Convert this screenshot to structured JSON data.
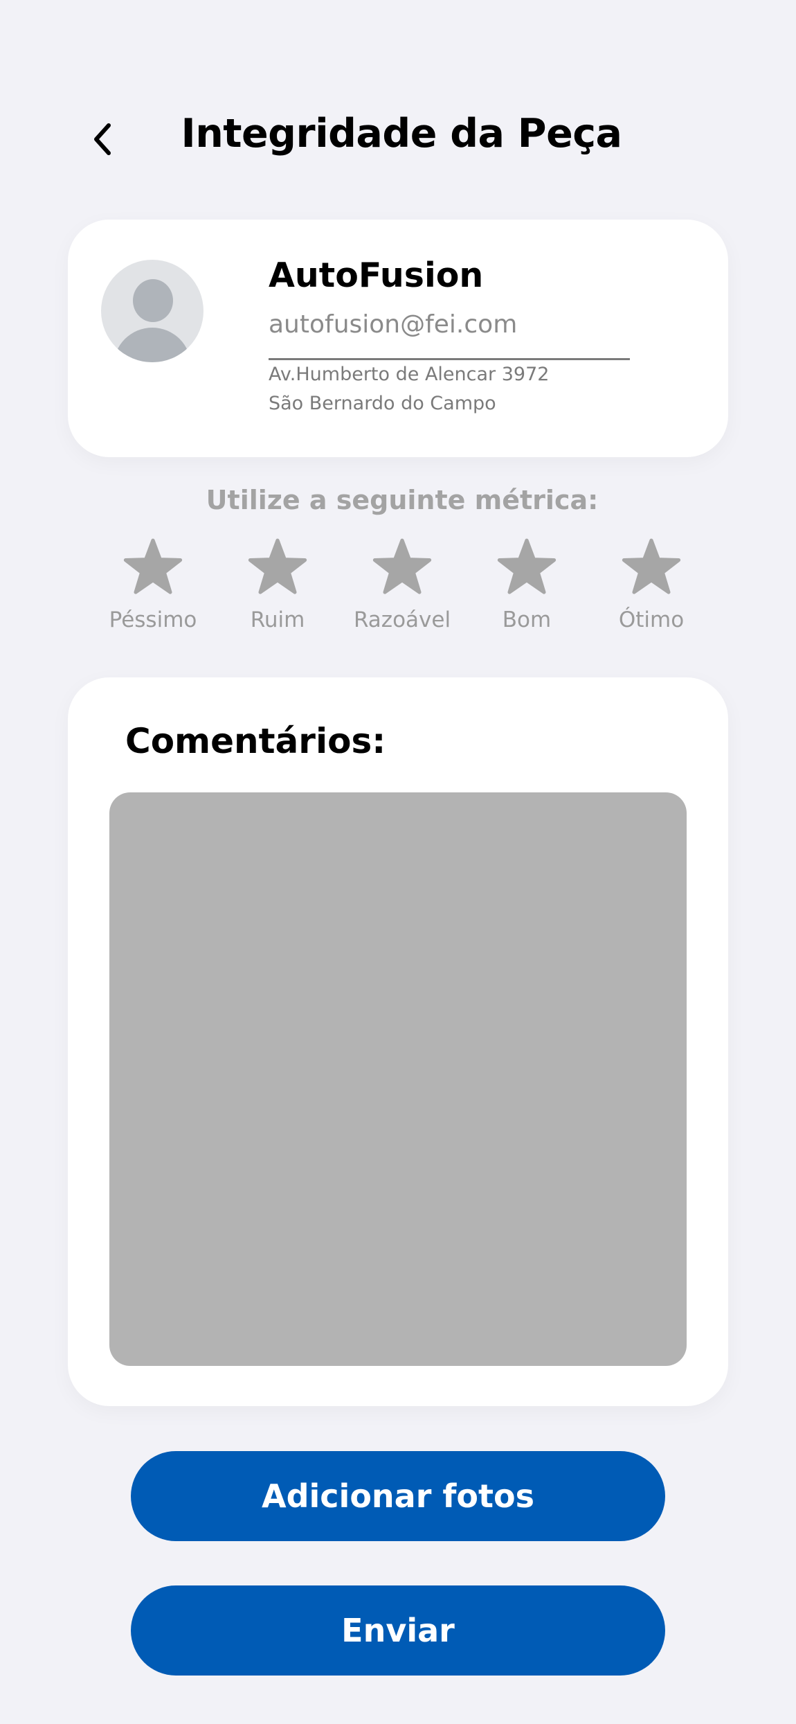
{
  "header": {
    "back_icon": "chevron-left-icon",
    "title": "Integridade da Peça"
  },
  "profile": {
    "avatar_icon": "user-placeholder-icon",
    "name": "AutoFusion",
    "email": "autofusion@fei.com",
    "address": "Av.Humberto de Alencar 3972",
    "city": "São Bernardo do Campo"
  },
  "rating": {
    "prompt": "Utilize a seguinte métrica:",
    "star_icon": "star-icon",
    "star_color": "#a6a6a6",
    "options": [
      {
        "label": "Péssimo"
      },
      {
        "label": "Ruim"
      },
      {
        "label": "Razoável"
      },
      {
        "label": "Bom"
      },
      {
        "label": "Ótimo"
      }
    ]
  },
  "comments": {
    "title": "Comentários:",
    "value": "",
    "box_color": "#b3b3b3"
  },
  "actions": {
    "add_photos_label": "Adicionar fotos",
    "send_label": "Enviar",
    "button_color": "#005bb5"
  },
  "colors": {
    "background": "#f2f2f7",
    "card": "#ffffff"
  }
}
